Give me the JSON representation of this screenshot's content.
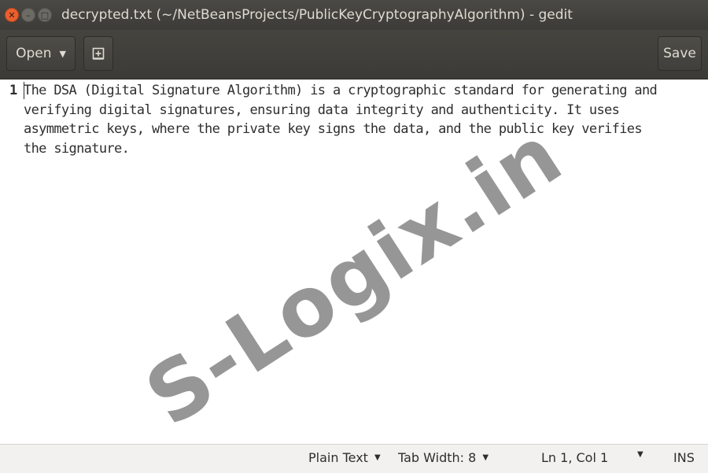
{
  "window": {
    "title": "decrypted.txt (~/NetBeansProjects/PublicKeyCryptographyAlgorithm) - gedit",
    "close_glyph": "✕",
    "minimize_glyph": "–",
    "maximize_glyph": "□"
  },
  "toolbar": {
    "open_label": "Open",
    "new_tab_glyph": "⊞",
    "save_label": "Save",
    "dropdown_glyph": "▼"
  },
  "editor": {
    "line_number": "1",
    "lines": [
      "The DSA (Digital Signature Algorithm) is a cryptographic standard for generating and",
      "verifying digital signatures, ensuring data integrity and authenticity. It uses",
      "asymmetric keys, where the private key signs the data, and the public key verifies",
      "the signature."
    ]
  },
  "watermark": {
    "text": "S-Logix.in"
  },
  "statusbar": {
    "language": "Plain Text",
    "tab_width": "Tab Width: 8",
    "position": "Ln 1, Col 1",
    "mode": "INS",
    "dropdown_glyph": "▼"
  },
  "colors": {
    "titlebar": "#3c3b37",
    "close_button": "#e9602f",
    "editor_background": "#ffffff",
    "statusbar": "#f2f1f0"
  }
}
